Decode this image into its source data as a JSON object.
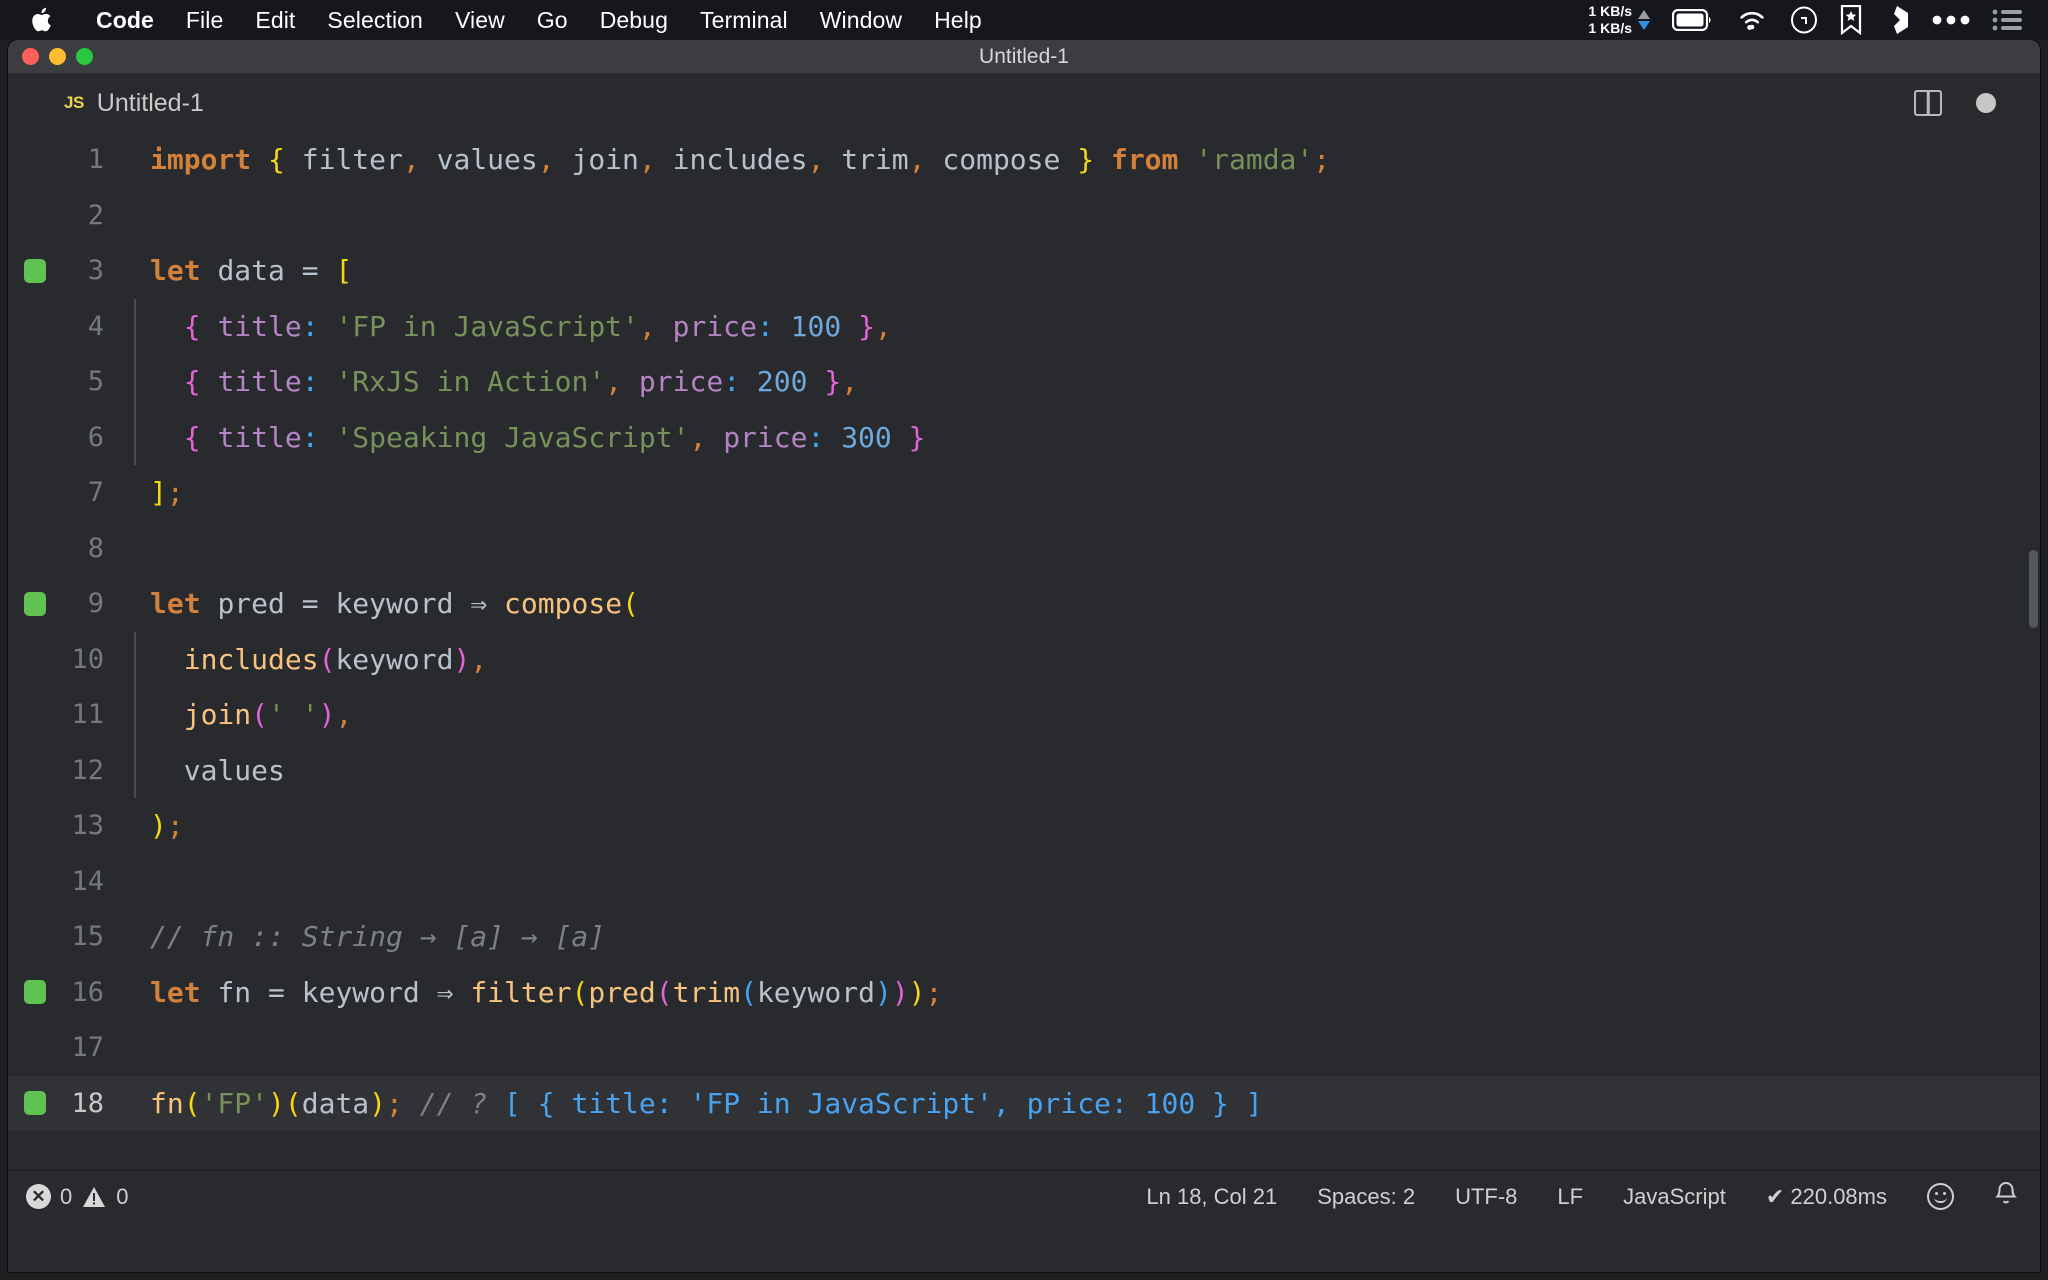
{
  "menubar": {
    "apple_icon": "apple-logo",
    "items": [
      {
        "label": "Code",
        "bold": true
      },
      {
        "label": "File"
      },
      {
        "label": "Edit"
      },
      {
        "label": "Selection"
      },
      {
        "label": "View"
      },
      {
        "label": "Go"
      },
      {
        "label": "Debug"
      },
      {
        "label": "Terminal"
      },
      {
        "label": "Window"
      },
      {
        "label": "Help"
      }
    ],
    "network": {
      "up": "1 KB/s",
      "down": "1 KB/s"
    },
    "status_icons": [
      "battery-icon",
      "wifi-icon",
      "siri-icon",
      "bookmark-icon",
      "shape-icon",
      "ellipsis-icon",
      "control-center-icon"
    ]
  },
  "window": {
    "title": "Untitled-1",
    "traffic_lights": [
      "close-button",
      "minimize-button",
      "maximize-button"
    ]
  },
  "tabbar": {
    "tab_badge": "JS",
    "tab_label": "Untitled-1",
    "actions": [
      "split-editor-icon",
      "unsaved-dot-icon"
    ]
  },
  "editor": {
    "lines": [
      {
        "n": "1",
        "marked": false,
        "active": false,
        "indent": false
      },
      {
        "n": "2",
        "marked": false,
        "active": false,
        "indent": false
      },
      {
        "n": "3",
        "marked": true,
        "active": false,
        "indent": false
      },
      {
        "n": "4",
        "marked": false,
        "active": false,
        "indent": true
      },
      {
        "n": "5",
        "marked": false,
        "active": false,
        "indent": true
      },
      {
        "n": "6",
        "marked": false,
        "active": false,
        "indent": true
      },
      {
        "n": "7",
        "marked": false,
        "active": false,
        "indent": false
      },
      {
        "n": "8",
        "marked": false,
        "active": false,
        "indent": false
      },
      {
        "n": "9",
        "marked": true,
        "active": false,
        "indent": false
      },
      {
        "n": "10",
        "marked": false,
        "active": false,
        "indent": true
      },
      {
        "n": "11",
        "marked": false,
        "active": false,
        "indent": true
      },
      {
        "n": "12",
        "marked": false,
        "active": false,
        "indent": true
      },
      {
        "n": "13",
        "marked": false,
        "active": false,
        "indent": false
      },
      {
        "n": "14",
        "marked": false,
        "active": false,
        "indent": false
      },
      {
        "n": "15",
        "marked": false,
        "active": false,
        "indent": false
      },
      {
        "n": "16",
        "marked": true,
        "active": false,
        "indent": false
      },
      {
        "n": "17",
        "marked": false,
        "active": false,
        "indent": false
      },
      {
        "n": "18",
        "marked": true,
        "active": true,
        "indent": false
      }
    ],
    "code": {
      "l1": [
        [
          "kw",
          "import"
        ],
        [
          "plain",
          " "
        ],
        [
          "br-y",
          "{"
        ],
        [
          "plain",
          " "
        ],
        [
          "ident",
          "filter"
        ],
        [
          "comma",
          ","
        ],
        [
          "plain",
          " "
        ],
        [
          "ident",
          "values"
        ],
        [
          "comma",
          ","
        ],
        [
          "plain",
          " "
        ],
        [
          "ident",
          "join"
        ],
        [
          "comma",
          ","
        ],
        [
          "plain",
          " "
        ],
        [
          "ident",
          "includes"
        ],
        [
          "comma",
          ","
        ],
        [
          "plain",
          " "
        ],
        [
          "ident",
          "trim"
        ],
        [
          "comma",
          ","
        ],
        [
          "plain",
          " "
        ],
        [
          "ident",
          "compose"
        ],
        [
          "plain",
          " "
        ],
        [
          "br-y",
          "}"
        ],
        [
          "plain",
          " "
        ],
        [
          "kw",
          "from"
        ],
        [
          "plain",
          " "
        ],
        [
          "str",
          "'ramda'"
        ],
        [
          "comma",
          ";"
        ]
      ],
      "l2": [],
      "l3": [
        [
          "kw",
          "let"
        ],
        [
          "plain",
          " "
        ],
        [
          "ident",
          "data"
        ],
        [
          "plain",
          " "
        ],
        [
          "op",
          "="
        ],
        [
          "plain",
          " "
        ],
        [
          "br-y",
          "["
        ]
      ],
      "l4": [
        [
          "plain",
          "  "
        ],
        [
          "br-p",
          "{"
        ],
        [
          "plain",
          " "
        ],
        [
          "prop",
          "title"
        ],
        [
          "br-b",
          ":"
        ],
        [
          "plain",
          " "
        ],
        [
          "str",
          "'FP in JavaScript'"
        ],
        [
          "comma",
          ","
        ],
        [
          "plain",
          " "
        ],
        [
          "prop",
          "price"
        ],
        [
          "br-b",
          ":"
        ],
        [
          "plain",
          " "
        ],
        [
          "num",
          "100"
        ],
        [
          "plain",
          " "
        ],
        [
          "br-p",
          "}"
        ],
        [
          "comma",
          ","
        ]
      ],
      "l5": [
        [
          "plain",
          "  "
        ],
        [
          "br-p",
          "{"
        ],
        [
          "plain",
          " "
        ],
        [
          "prop",
          "title"
        ],
        [
          "br-b",
          ":"
        ],
        [
          "plain",
          " "
        ],
        [
          "str",
          "'RxJS in Action'"
        ],
        [
          "comma",
          ","
        ],
        [
          "plain",
          " "
        ],
        [
          "prop",
          "price"
        ],
        [
          "br-b",
          ":"
        ],
        [
          "plain",
          " "
        ],
        [
          "num",
          "200"
        ],
        [
          "plain",
          " "
        ],
        [
          "br-p",
          "}"
        ],
        [
          "comma",
          ","
        ]
      ],
      "l6": [
        [
          "plain",
          "  "
        ],
        [
          "br-p",
          "{"
        ],
        [
          "plain",
          " "
        ],
        [
          "prop",
          "title"
        ],
        [
          "br-b",
          ":"
        ],
        [
          "plain",
          " "
        ],
        [
          "str",
          "'Speaking JavaScript'"
        ],
        [
          "comma",
          ","
        ],
        [
          "plain",
          " "
        ],
        [
          "prop",
          "price"
        ],
        [
          "br-b",
          ":"
        ],
        [
          "plain",
          " "
        ],
        [
          "num",
          "300"
        ],
        [
          "plain",
          " "
        ],
        [
          "br-p",
          "}"
        ]
      ],
      "l7": [
        [
          "br-y",
          "]"
        ],
        [
          "comma",
          ";"
        ]
      ],
      "l8": [],
      "l9": [
        [
          "kw",
          "let"
        ],
        [
          "plain",
          " "
        ],
        [
          "ident",
          "pred"
        ],
        [
          "plain",
          " "
        ],
        [
          "op",
          "="
        ],
        [
          "plain",
          " "
        ],
        [
          "ident",
          "keyword"
        ],
        [
          "plain",
          " "
        ],
        [
          "arrow",
          "⇒"
        ],
        [
          "plain",
          " "
        ],
        [
          "fn",
          "compose"
        ],
        [
          "br-y",
          "("
        ]
      ],
      "l10": [
        [
          "plain",
          "  "
        ],
        [
          "fn",
          "includes"
        ],
        [
          "br-p",
          "("
        ],
        [
          "ident",
          "keyword"
        ],
        [
          "br-p",
          ")"
        ],
        [
          "comma",
          ","
        ]
      ],
      "l11": [
        [
          "plain",
          "  "
        ],
        [
          "fn",
          "join"
        ],
        [
          "br-p",
          "("
        ],
        [
          "str",
          "' '"
        ],
        [
          "br-p",
          ")"
        ],
        [
          "comma",
          ","
        ]
      ],
      "l12": [
        [
          "plain",
          "  "
        ],
        [
          "ident",
          "values"
        ]
      ],
      "l13": [
        [
          "br-y",
          ")"
        ],
        [
          "comma",
          ";"
        ]
      ],
      "l14": [],
      "l15": [
        [
          "comment",
          "// fn :: String → [a] → [a]"
        ]
      ],
      "l16": [
        [
          "kw",
          "let"
        ],
        [
          "plain",
          " "
        ],
        [
          "ident",
          "fn"
        ],
        [
          "plain",
          " "
        ],
        [
          "op",
          "="
        ],
        [
          "plain",
          " "
        ],
        [
          "ident",
          "keyword"
        ],
        [
          "plain",
          " "
        ],
        [
          "arrow",
          "⇒"
        ],
        [
          "plain",
          " "
        ],
        [
          "fn",
          "filter"
        ],
        [
          "br-y",
          "("
        ],
        [
          "fn",
          "pred"
        ],
        [
          "br-p",
          "("
        ],
        [
          "fn",
          "trim"
        ],
        [
          "br-b",
          "("
        ],
        [
          "ident",
          "keyword"
        ],
        [
          "br-b",
          ")"
        ],
        [
          "br-p",
          ")"
        ],
        [
          "br-y",
          ")"
        ],
        [
          "comma",
          ";"
        ]
      ],
      "l17": [],
      "l18": [
        [
          "fn",
          "fn"
        ],
        [
          "br-y",
          "("
        ],
        [
          "str",
          "'FP'"
        ],
        [
          "br-y",
          ")"
        ],
        [
          "br-y",
          "("
        ],
        [
          "ident",
          "data"
        ],
        [
          "br-y",
          ")"
        ],
        [
          "comma",
          ";"
        ],
        [
          "plain",
          " "
        ],
        [
          "comment",
          "// ?"
        ],
        [
          "plain",
          " "
        ],
        [
          "result",
          "[ { title: 'FP in JavaScript', price: 100 } ]"
        ]
      ]
    }
  },
  "statusbar": {
    "errors": "0",
    "warnings": "0",
    "cursor": "Ln 18, Col 21",
    "spaces": "Spaces: 2",
    "encoding": "UTF-8",
    "eol": "LF",
    "language": "JavaScript",
    "timing": "✔ 220.08ms",
    "feedback_icon": "smiley-icon",
    "notifications_icon": "bell-icon"
  },
  "colors": {
    "background": "#282a2e",
    "menubar": "#16161d",
    "keyword": "#d2803a",
    "string": "#76915a",
    "number": "#6fa8dc",
    "function": "#f7c47f",
    "property": "#b584c4",
    "comment": "#7d8186",
    "result": "#4aa3f0",
    "marker_green": "#61c254"
  }
}
